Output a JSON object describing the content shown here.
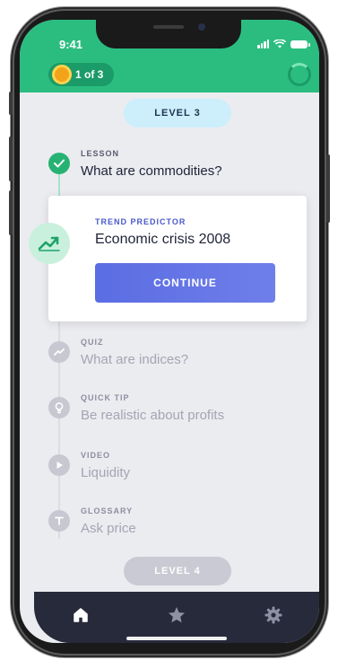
{
  "status_bar": {
    "time": "9:41"
  },
  "header": {
    "progress_label": "1 of 3"
  },
  "levels": {
    "current": "LEVEL 3",
    "next": "LEVEL 4"
  },
  "steps": [
    {
      "kicker": "LESSON",
      "title": "What are commodities?",
      "state": "done",
      "icon": "check-icon"
    },
    {
      "kicker": "QUIZ",
      "title": "What are indices?",
      "state": "locked",
      "icon": "quiz-icon"
    },
    {
      "kicker": "QUICK TIP",
      "title": "Be realistic about profits",
      "state": "locked",
      "icon": "lightbulb-icon"
    },
    {
      "kicker": "VIDEO",
      "title": "Liquidity",
      "state": "locked",
      "icon": "play-icon"
    },
    {
      "kicker": "GLOSSARY",
      "title": "Ask price",
      "state": "locked",
      "icon": "glossary-icon"
    }
  ],
  "active_card": {
    "kicker": "TREND PREDICTOR",
    "title": "Economic crisis 2008",
    "button_label": "CONTINUE",
    "icon": "trend-up-icon"
  },
  "bottom_nav": [
    {
      "name": "home",
      "icon": "home-icon",
      "active": true
    },
    {
      "name": "favorites",
      "icon": "star-icon",
      "active": false
    },
    {
      "name": "settings",
      "icon": "gear-icon",
      "active": false
    }
  ],
  "colors": {
    "brand_green": "#2bbd80",
    "accent_blue": "#5b6de3",
    "nav_bg": "#272a3b"
  }
}
